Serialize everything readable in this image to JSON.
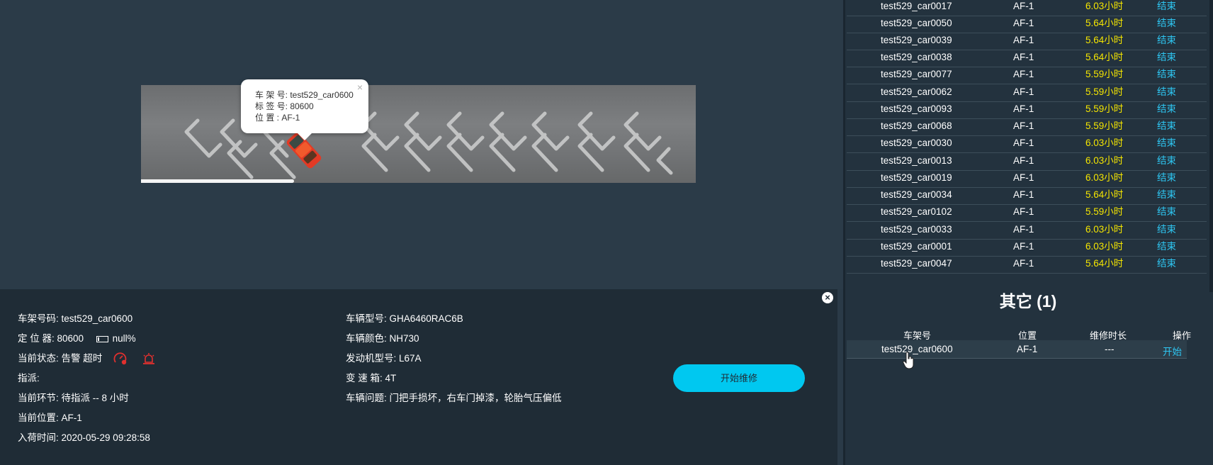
{
  "popup": {
    "frame_label": "车 架 号: test529_car0600",
    "tag_label": "标 签 号: 80600",
    "location_label": "位 置 : AF-1",
    "close_icon": "×"
  },
  "detail": {
    "close_icon": "×",
    "left": {
      "frame_no": "车架号码: test529_car0600",
      "locator": "定 位 器: 80600",
      "battery": "null%",
      "status": "当前状态: 告警 超时",
      "assign": "指派:",
      "stage": "当前环节: 待指派 -- 8 小时",
      "position": "当前位置: AF-1",
      "entry_time": "入荷时间: 2020-05-29 09:28:58"
    },
    "mid": {
      "model": "车辆型号: GHA6460RAC6B",
      "color": "车辆颜色: NH730",
      "engine": "发动机型号: L67A",
      "gearbox": "变 速 箱: 4T",
      "issue": "车辆问题: 门把手损坏，右车门掉漆，轮胎气压偏低"
    },
    "start_repair_button": "开始维修",
    "status_colors": {
      "alarm": "#e0302e"
    }
  },
  "repair_list": {
    "rows": [
      {
        "frame": "test529_car0017",
        "position": "AF-1",
        "duration": "6.03小时",
        "action": "结束"
      },
      {
        "frame": "test529_car0050",
        "position": "AF-1",
        "duration": "5.64小时",
        "action": "结束"
      },
      {
        "frame": "test529_car0039",
        "position": "AF-1",
        "duration": "5.64小时",
        "action": "结束"
      },
      {
        "frame": "test529_car0038",
        "position": "AF-1",
        "duration": "5.64小时",
        "action": "结束"
      },
      {
        "frame": "test529_car0077",
        "position": "AF-1",
        "duration": "5.59小时",
        "action": "结束"
      },
      {
        "frame": "test529_car0062",
        "position": "AF-1",
        "duration": "5.59小时",
        "action": "结束"
      },
      {
        "frame": "test529_car0093",
        "position": "AF-1",
        "duration": "5.59小时",
        "action": "结束"
      },
      {
        "frame": "test529_car0068",
        "position": "AF-1",
        "duration": "5.59小时",
        "action": "结束"
      },
      {
        "frame": "test529_car0030",
        "position": "AF-1",
        "duration": "6.03小时",
        "action": "结束"
      },
      {
        "frame": "test529_car0013",
        "position": "AF-1",
        "duration": "6.03小时",
        "action": "结束"
      },
      {
        "frame": "test529_car0019",
        "position": "AF-1",
        "duration": "6.03小时",
        "action": "结束"
      },
      {
        "frame": "test529_car0034",
        "position": "AF-1",
        "duration": "5.64小时",
        "action": "结束"
      },
      {
        "frame": "test529_car0102",
        "position": "AF-1",
        "duration": "5.59小时",
        "action": "结束"
      },
      {
        "frame": "test529_car0033",
        "position": "AF-1",
        "duration": "6.03小时",
        "action": "结束"
      },
      {
        "frame": "test529_car0001",
        "position": "AF-1",
        "duration": "6.03小时",
        "action": "结束"
      },
      {
        "frame": "test529_car0047",
        "position": "AF-1",
        "duration": "5.64小时",
        "action": "结束"
      }
    ],
    "colors": {
      "duration": "#f5e600",
      "action": "#2ec6f2"
    }
  },
  "other": {
    "title": "其它 (1)",
    "headers": {
      "frame": "车架号",
      "position": "位置",
      "duration": "维修时长",
      "action": "操作"
    },
    "rows": [
      {
        "frame": "test529_car0600",
        "position": "AF-1",
        "duration": "---",
        "action": "开始"
      }
    ]
  }
}
